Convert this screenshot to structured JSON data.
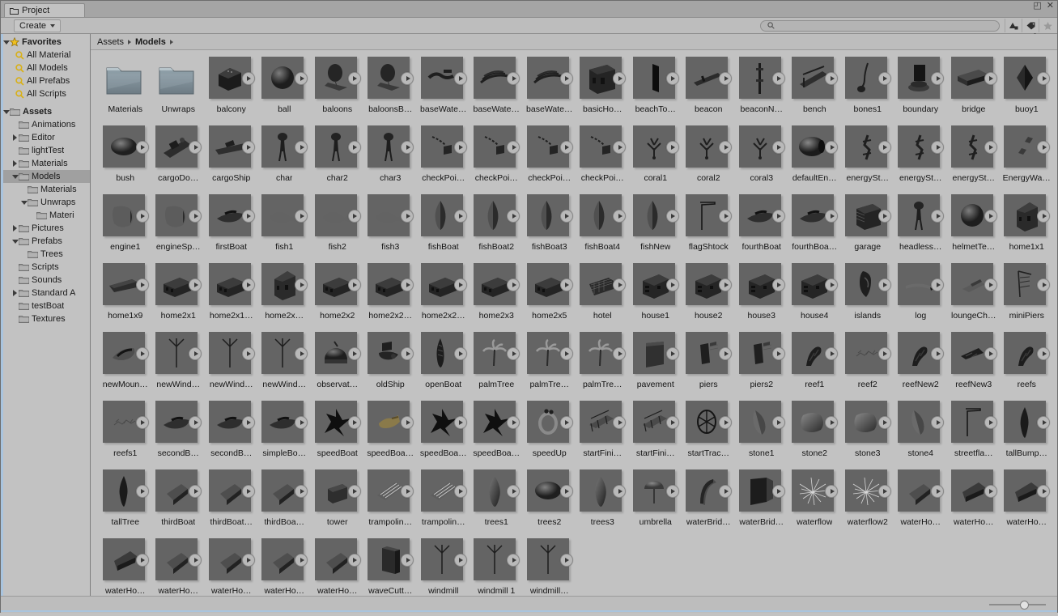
{
  "window": {
    "tab_title": "Project",
    "tab_icon": "folder-icon",
    "maximize_label": "◰",
    "close_label": "✕",
    "lock_icon": "lock-icon",
    "menu_icon": "hamburger-menu-icon"
  },
  "toolbar": {
    "create_label": "Create",
    "create_caret": "▾",
    "search_placeholder": "",
    "search_value": "",
    "search_icon": "search-icon",
    "icons": [
      {
        "name": "filter-by-type-icon",
        "glyph": "type"
      },
      {
        "name": "filter-by-label-icon",
        "glyph": "label"
      },
      {
        "name": "favorite-star-icon",
        "glyph": "star"
      }
    ]
  },
  "sidebar": {
    "favorites": {
      "label": "Favorites",
      "expanded": true,
      "icon": "star-icon",
      "items": [
        {
          "label": "All Material",
          "icon": "search-icon"
        },
        {
          "label": "All Models",
          "icon": "search-icon"
        },
        {
          "label": "All Prefabs",
          "icon": "search-icon"
        },
        {
          "label": "All Scripts",
          "icon": "search-icon"
        }
      ]
    },
    "assets": {
      "label": "Assets",
      "expanded": true,
      "items": [
        {
          "label": "Animations",
          "indent": 1,
          "twisty": "none",
          "selected": false
        },
        {
          "label": "Editor",
          "indent": 1,
          "twisty": "collapsed",
          "selected": false
        },
        {
          "label": "lightTest",
          "indent": 1,
          "twisty": "none",
          "selected": false
        },
        {
          "label": "Materials",
          "indent": 1,
          "twisty": "collapsed",
          "selected": false
        },
        {
          "label": "Models",
          "indent": 1,
          "twisty": "expanded",
          "selected": true
        },
        {
          "label": "Materials",
          "indent": 2,
          "twisty": "none",
          "selected": false
        },
        {
          "label": "Unwraps",
          "indent": 2,
          "twisty": "expanded",
          "selected": false
        },
        {
          "label": "Materi",
          "indent": 3,
          "twisty": "none",
          "selected": false
        },
        {
          "label": "Pictures",
          "indent": 1,
          "twisty": "collapsed",
          "selected": false
        },
        {
          "label": "Prefabs",
          "indent": 1,
          "twisty": "expanded",
          "selected": false
        },
        {
          "label": "Trees",
          "indent": 2,
          "twisty": "none",
          "selected": false
        },
        {
          "label": "Scripts",
          "indent": 1,
          "twisty": "none",
          "selected": false
        },
        {
          "label": "Sounds",
          "indent": 1,
          "twisty": "none",
          "selected": false
        },
        {
          "label": "Standard A",
          "indent": 1,
          "twisty": "collapsed",
          "selected": false
        },
        {
          "label": "testBoat",
          "indent": 1,
          "twisty": "none",
          "selected": false
        },
        {
          "label": "Textures",
          "indent": 1,
          "twisty": "none",
          "selected": false
        }
      ]
    }
  },
  "breadcrumb": {
    "items": [
      "Assets",
      "Models"
    ],
    "separator": "▸"
  },
  "bottom": {
    "zoom_slider_value": 63
  },
  "assets": [
    {
      "label": "Materials",
      "type": "folder"
    },
    {
      "label": "Unwraps",
      "type": "folder"
    },
    {
      "label": "balcony",
      "type": "model",
      "shape": "box"
    },
    {
      "label": "ball",
      "type": "model",
      "shape": "sphere"
    },
    {
      "label": "baloons",
      "type": "model",
      "shape": "balloon"
    },
    {
      "label": "baloonsB…",
      "type": "model",
      "shape": "balloon"
    },
    {
      "label": "baseWate…",
      "type": "model",
      "shape": "squiggle"
    },
    {
      "label": "baseWate…",
      "type": "model",
      "shape": "streak"
    },
    {
      "label": "baseWate…",
      "type": "model",
      "shape": "streak"
    },
    {
      "label": "basicHo…",
      "type": "model",
      "shape": "building"
    },
    {
      "label": "beachTo…",
      "type": "model",
      "shape": "slab"
    },
    {
      "label": "beacon",
      "type": "model",
      "shape": "rod"
    },
    {
      "label": "beaconN…",
      "type": "model",
      "shape": "pole"
    },
    {
      "label": "bench",
      "type": "model",
      "shape": "bench"
    },
    {
      "label": "bones1",
      "type": "model",
      "shape": "bones"
    },
    {
      "label": "boundary",
      "type": "model",
      "shape": "tower"
    },
    {
      "label": "bridge",
      "type": "model",
      "shape": "bridge"
    },
    {
      "label": "buoy1",
      "type": "model",
      "shape": "buoy"
    },
    {
      "label": "bush",
      "type": "model",
      "shape": "blob"
    },
    {
      "label": "cargoDo…",
      "type": "model",
      "shape": "dock"
    },
    {
      "label": "cargoShip",
      "type": "model",
      "shape": "ship"
    },
    {
      "label": "char",
      "type": "model",
      "shape": "char"
    },
    {
      "label": "char2",
      "type": "model",
      "shape": "char"
    },
    {
      "label": "char3",
      "type": "model",
      "shape": "char"
    },
    {
      "label": "checkPoi…",
      "type": "model",
      "shape": "flagpole"
    },
    {
      "label": "checkPoi…",
      "type": "model",
      "shape": "flagpole"
    },
    {
      "label": "checkPoi…",
      "type": "model",
      "shape": "flagpole"
    },
    {
      "label": "checkPoi…",
      "type": "model",
      "shape": "flagpole"
    },
    {
      "label": "coral1",
      "type": "model",
      "shape": "coral"
    },
    {
      "label": "coral2",
      "type": "model",
      "shape": "coral"
    },
    {
      "label": "coral3",
      "type": "model",
      "shape": "coral"
    },
    {
      "label": "defaultEn…",
      "type": "model",
      "shape": "egg"
    },
    {
      "label": "energySt…",
      "type": "model",
      "shape": "rig"
    },
    {
      "label": "energySt…",
      "type": "model",
      "shape": "rig"
    },
    {
      "label": "energySt…",
      "type": "model",
      "shape": "rig"
    },
    {
      "label": "EnergyWa…",
      "type": "model",
      "shape": "shards"
    },
    {
      "label": "engine1",
      "type": "model",
      "shape": "engine"
    },
    {
      "label": "engineSp…",
      "type": "model",
      "shape": "engine"
    },
    {
      "label": "firstBoat",
      "type": "model",
      "shape": "boat"
    },
    {
      "label": "fish1",
      "type": "model",
      "shape": "fish"
    },
    {
      "label": "fish2",
      "type": "model",
      "shape": "fish"
    },
    {
      "label": "fish3",
      "type": "model",
      "shape": "fish"
    },
    {
      "label": "fishBoat",
      "type": "model",
      "shape": "hull"
    },
    {
      "label": "fishBoat2",
      "type": "model",
      "shape": "hull"
    },
    {
      "label": "fishBoat3",
      "type": "model",
      "shape": "hull"
    },
    {
      "label": "fishBoat4",
      "type": "model",
      "shape": "hull"
    },
    {
      "label": "fishNew",
      "type": "model",
      "shape": "hull"
    },
    {
      "label": "flagShtock",
      "type": "model",
      "shape": "flagstick"
    },
    {
      "label": "fourthBoat",
      "type": "model",
      "shape": "boat"
    },
    {
      "label": "fourthBoa…",
      "type": "model",
      "shape": "boat"
    },
    {
      "label": "garage",
      "type": "model",
      "shape": "garage"
    },
    {
      "label": "headless…",
      "type": "model",
      "shape": "char"
    },
    {
      "label": "helmetTe…",
      "type": "model",
      "shape": "sphere"
    },
    {
      "label": "home1x1",
      "type": "model",
      "shape": "house"
    },
    {
      "label": "home1x9",
      "type": "model",
      "shape": "rowhouse"
    },
    {
      "label": "home2x1",
      "type": "model",
      "shape": "block"
    },
    {
      "label": "home2x1…",
      "type": "model",
      "shape": "block"
    },
    {
      "label": "home2x…",
      "type": "model",
      "shape": "house"
    },
    {
      "label": "home2x2",
      "type": "model",
      "shape": "block"
    },
    {
      "label": "home2x2…",
      "type": "model",
      "shape": "block"
    },
    {
      "label": "home2x2…",
      "type": "model",
      "shape": "block"
    },
    {
      "label": "home2x3",
      "type": "model",
      "shape": "block"
    },
    {
      "label": "home2x5",
      "type": "model",
      "shape": "block"
    },
    {
      "label": "hotel",
      "type": "model",
      "shape": "hotel"
    },
    {
      "label": "house1",
      "type": "model",
      "shape": "house2"
    },
    {
      "label": "house2",
      "type": "model",
      "shape": "house2"
    },
    {
      "label": "house3",
      "type": "model",
      "shape": "house2"
    },
    {
      "label": "house4",
      "type": "model",
      "shape": "house2"
    },
    {
      "label": "islands",
      "type": "model",
      "shape": "island"
    },
    {
      "label": "log",
      "type": "model",
      "shape": "log"
    },
    {
      "label": "loungeCh…",
      "type": "model",
      "shape": "chair"
    },
    {
      "label": "miniPiers",
      "type": "model",
      "shape": "piers"
    },
    {
      "label": "newMoun…",
      "type": "model",
      "shape": "mound"
    },
    {
      "label": "newWind…",
      "type": "model",
      "shape": "windmill"
    },
    {
      "label": "newWind…",
      "type": "model",
      "shape": "windmill"
    },
    {
      "label": "newWind…",
      "type": "model",
      "shape": "windmill"
    },
    {
      "label": "observat…",
      "type": "model",
      "shape": "dome"
    },
    {
      "label": "oldShip",
      "type": "model",
      "shape": "wreck"
    },
    {
      "label": "openBoat",
      "type": "model",
      "shape": "openboat"
    },
    {
      "label": "palmTree",
      "type": "model",
      "shape": "palm"
    },
    {
      "label": "palmTre…",
      "type": "model",
      "shape": "palm"
    },
    {
      "label": "palmTre…",
      "type": "model",
      "shape": "palm"
    },
    {
      "label": "pavement",
      "type": "model",
      "shape": "slabbig"
    },
    {
      "label": "piers",
      "type": "model",
      "shape": "pier"
    },
    {
      "label": "piers2",
      "type": "model",
      "shape": "pier"
    },
    {
      "label": "reef1",
      "type": "model",
      "shape": "reef"
    },
    {
      "label": "reef2",
      "type": "model",
      "shape": "reeffine"
    },
    {
      "label": "reefNew2",
      "type": "model",
      "shape": "reef"
    },
    {
      "label": "reefNew3",
      "type": "model",
      "shape": "reefwing"
    },
    {
      "label": "reefs",
      "type": "model",
      "shape": "reef"
    },
    {
      "label": "reefs1",
      "type": "model",
      "shape": "reeffine"
    },
    {
      "label": "secondB…",
      "type": "model",
      "shape": "boat"
    },
    {
      "label": "secondB…",
      "type": "model",
      "shape": "boat"
    },
    {
      "label": "simpleBo…",
      "type": "model",
      "shape": "boat"
    },
    {
      "label": "speedBoat",
      "type": "model",
      "shape": "speed"
    },
    {
      "label": "speedBoa…",
      "type": "model",
      "shape": "speedtan"
    },
    {
      "label": "speedBoa…",
      "type": "model",
      "shape": "speed"
    },
    {
      "label": "speedBoa…",
      "type": "model",
      "shape": "speed"
    },
    {
      "label": "speedUp",
      "type": "model",
      "shape": "ring"
    },
    {
      "label": "startFini…",
      "type": "model",
      "shape": "gate"
    },
    {
      "label": "startFini…",
      "type": "model",
      "shape": "gate"
    },
    {
      "label": "startTrac…",
      "type": "model",
      "shape": "wheel"
    },
    {
      "label": "stone1",
      "type": "model",
      "shape": "stone"
    },
    {
      "label": "stone2",
      "type": "model",
      "shape": "rock"
    },
    {
      "label": "stone3",
      "type": "model",
      "shape": "rock"
    },
    {
      "label": "stone4",
      "type": "model",
      "shape": "stone"
    },
    {
      "label": "streetfla…",
      "type": "model",
      "shape": "flagstick"
    },
    {
      "label": "tallBump…",
      "type": "model",
      "shape": "spire"
    },
    {
      "label": "tallTree",
      "type": "model",
      "shape": "spire"
    },
    {
      "label": "thirdBoat",
      "type": "model",
      "shape": "chunk"
    },
    {
      "label": "thirdBoat…",
      "type": "model",
      "shape": "chunk"
    },
    {
      "label": "thirdBoa…",
      "type": "model",
      "shape": "chunk"
    },
    {
      "label": "tower",
      "type": "model",
      "shape": "barrel"
    },
    {
      "label": "trampolin…",
      "type": "model",
      "shape": "mat"
    },
    {
      "label": "trampolin…",
      "type": "model",
      "shape": "mat"
    },
    {
      "label": "trees1",
      "type": "model",
      "shape": "leaf"
    },
    {
      "label": "trees2",
      "type": "model",
      "shape": "blob"
    },
    {
      "label": "trees3",
      "type": "model",
      "shape": "leaf"
    },
    {
      "label": "umbrella",
      "type": "model",
      "shape": "umbrella"
    },
    {
      "label": "waterBrid…",
      "type": "model",
      "shape": "arch"
    },
    {
      "label": "waterBrid…",
      "type": "model",
      "shape": "wall"
    },
    {
      "label": "waterflow",
      "type": "model",
      "shape": "burst"
    },
    {
      "label": "waterflow2",
      "type": "model",
      "shape": "burst"
    },
    {
      "label": "waterHo…",
      "type": "model",
      "shape": "chunk"
    },
    {
      "label": "waterHo…",
      "type": "model",
      "shape": "wedge"
    },
    {
      "label": "waterHo…",
      "type": "model",
      "shape": "wedge"
    },
    {
      "label": "waterHo…",
      "type": "model",
      "shape": "wedge"
    },
    {
      "label": "waterHo…",
      "type": "model",
      "shape": "chunk"
    },
    {
      "label": "waterHo…",
      "type": "model",
      "shape": "chunk"
    },
    {
      "label": "waterHo…",
      "type": "model",
      "shape": "chunk"
    },
    {
      "label": "waterHo…",
      "type": "model",
      "shape": "chunk"
    },
    {
      "label": "waveCutt…",
      "type": "model",
      "shape": "pillar"
    },
    {
      "label": "windmill",
      "type": "model",
      "shape": "windmill"
    },
    {
      "label": "windmill 1",
      "type": "model",
      "shape": "windmill"
    },
    {
      "label": "windmill…",
      "type": "model",
      "shape": "windmill"
    }
  ]
}
